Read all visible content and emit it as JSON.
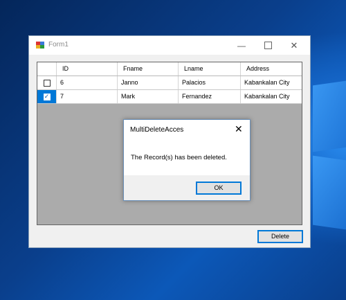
{
  "window": {
    "title": "Form1",
    "minimize_glyph": "—",
    "close_glyph": "✕",
    "app_icon": "form-icon"
  },
  "grid": {
    "columns": [
      "",
      "ID",
      "Fname",
      "Lname",
      "Address"
    ],
    "rows": [
      {
        "checked": false,
        "id": "6",
        "fname": "Janno",
        "lname": "Palacios",
        "address": "Kabankalan City"
      },
      {
        "checked": true,
        "id": "7",
        "fname": "Mark",
        "lname": "Fernandez",
        "address": "Kabankalan City"
      }
    ],
    "check_glyph": "✓"
  },
  "delete_button": {
    "label": "Delete"
  },
  "dialog": {
    "title": "MultiDeleteAcces",
    "close_glyph": "✕",
    "message": "The Record(s) has been deleted.",
    "ok_label": "OK"
  },
  "colors": {
    "selection": "#0078d7",
    "desktop": "#0a3e86"
  }
}
